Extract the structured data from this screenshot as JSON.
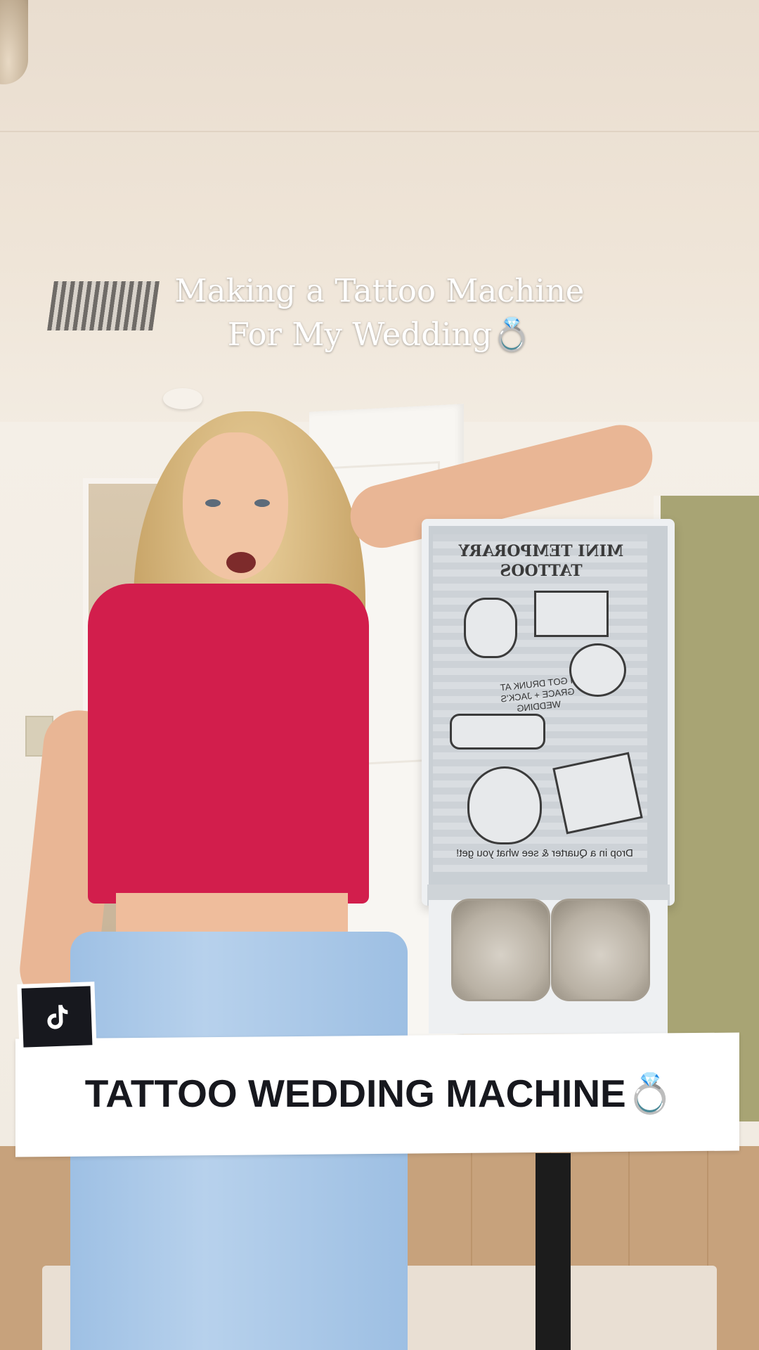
{
  "video": {
    "title_overlay": {
      "line1": "Making a Tattoo Machine",
      "line2": "For My Wedding💍"
    },
    "caption_banner": {
      "text": "TATTOO WEDDING MACHINE",
      "emoji": "💍"
    },
    "badge": {
      "icon": "tiktok-icon"
    }
  },
  "machine": {
    "header": "MINI TEMPORARY TATTOOS",
    "tattoo_text": "I GOT DRUNK AT GRACE + JACK'S WEDDING",
    "footer": "Drop in a Quarter & see what you get!"
  },
  "colors": {
    "banner_bg": "#ffffff",
    "banner_text": "#17181e",
    "shirt": "#d21e4c",
    "badge_bg": "#17181e"
  }
}
